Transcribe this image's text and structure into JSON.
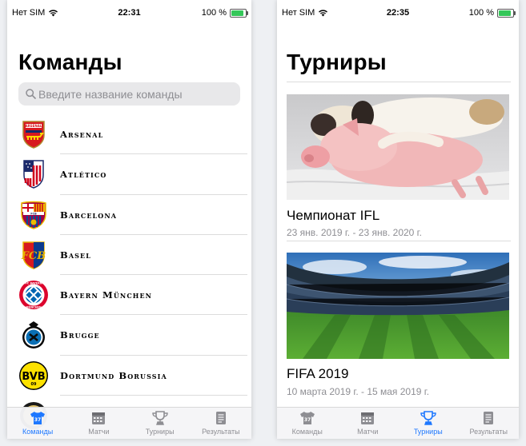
{
  "status_left": {
    "carrier": "Нет SIM",
    "time": "22:31",
    "battery": "100 %"
  },
  "status_right": {
    "carrier": "Нет SIM",
    "time": "22:35",
    "battery": "100 %"
  },
  "teams_screen": {
    "title": "Команды",
    "search_placeholder": "Введите название команды",
    "teams": [
      {
        "name": "Arsenal",
        "logo": "arsenal-logo"
      },
      {
        "name": "Atlético",
        "logo": "atletico-logo"
      },
      {
        "name": "Barcelona",
        "logo": "barcelona-logo"
      },
      {
        "name": "Basel",
        "logo": "basel-logo"
      },
      {
        "name": "Bayern München",
        "logo": "bayern-logo"
      },
      {
        "name": "Brugge",
        "logo": "brugge-logo"
      },
      {
        "name": "Dortmund Borussia",
        "logo": "dortmund-logo"
      }
    ]
  },
  "tournaments_screen": {
    "title": "Турниры",
    "tournaments": [
      {
        "title": "Чемпионат IFL",
        "dates": "23 янв. 2019 г. - 23 янв. 2020 г.",
        "image": "dog-and-pig-photo"
      },
      {
        "title": "FIFA 2019",
        "dates": "10 марта 2019 г. - 15 мая 2019 г.",
        "image": "stadium-photo"
      }
    ]
  },
  "tabbar": {
    "items": [
      {
        "label": "Команды",
        "icon": "jersey-icon"
      },
      {
        "label": "Матчи",
        "icon": "calendar-icon"
      },
      {
        "label": "Турниры",
        "icon": "trophy-icon"
      },
      {
        "label": "Результаты",
        "icon": "scores-icon"
      }
    ],
    "active_left": "Команды",
    "active_right": "Турниры",
    "active_color": "#1e78ff",
    "inactive_color": "#8e8e93"
  }
}
